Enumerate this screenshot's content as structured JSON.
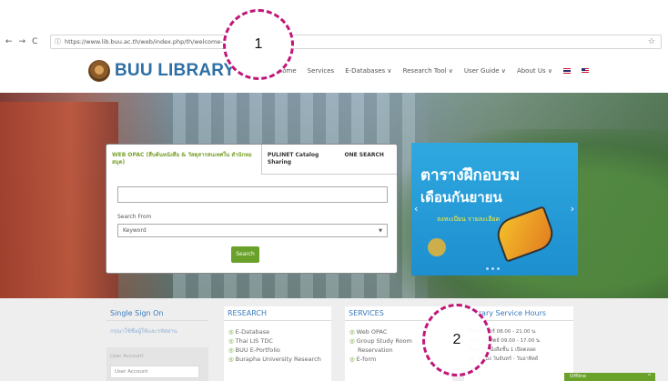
{
  "browser": {
    "nav": [
      "←",
      "→",
      "C"
    ],
    "info_icon": "ⓘ",
    "url": "https://www.lib.buu.ac.th/web/index.php/th/welcome-2/",
    "star": "☆"
  },
  "site": {
    "logo_text": "BUU LIBRARY",
    "menu": [
      "Home",
      "Services",
      "E-Databases ∨",
      "Research Tool ∨",
      "User Guide ∨",
      "About Us ∨"
    ]
  },
  "search": {
    "tabs": {
      "opac": "WEB OPAC (สืบค้นหนังสือ & วัสดุสารสนเทศใน สำนักหอสมุด)",
      "pulinet": "PULINET Catalog Sharing",
      "one": "ONE SEARCH"
    },
    "input_value": "",
    "from_label": "Search From",
    "select_value": "Keyword",
    "button": "Search"
  },
  "banner": {
    "title1": "ตารางฝึกอบรม",
    "title2": "เดือนกันยายน",
    "sub": "ลงทะเบียน รายละเอียด"
  },
  "sso": {
    "title": "Single Sign On",
    "note": "กรุณาใช้ชื่อผู้ใช้และรหัสผ่าน",
    "label": "User Account",
    "placeholder": "User Account"
  },
  "research": {
    "title": "RESEARCH",
    "items": [
      "E-Database",
      "Thai LIS TDC",
      "BUU E-Portfolio",
      "Burapha University Research"
    ]
  },
  "services": {
    "title": "SERVICES",
    "items": [
      "Web OPAC",
      "Group Study Room",
      "Reservation",
      "E-form"
    ]
  },
  "hours": {
    "title": "Library Service Hours",
    "items": [
      "จันทร์ - ศุกร์ 08.00 - 21.00 น.",
      "เสาร์ - อาทิตย์ 09.00 - 17.00 น.",
      "ห้องอ่านหนังสือชั้น 1 เปิดตลอด",
      "24 ชั่วโมง วันจันทร์ - วันอาทิตย์"
    ]
  },
  "chat": {
    "label": "Offline",
    "caret": "^"
  },
  "annotations": {
    "one": "1",
    "two": "2"
  },
  "colors": {
    "brand": "#2e6fa5",
    "accent_green": "#6aa12a",
    "annotation": "#c0167a"
  }
}
